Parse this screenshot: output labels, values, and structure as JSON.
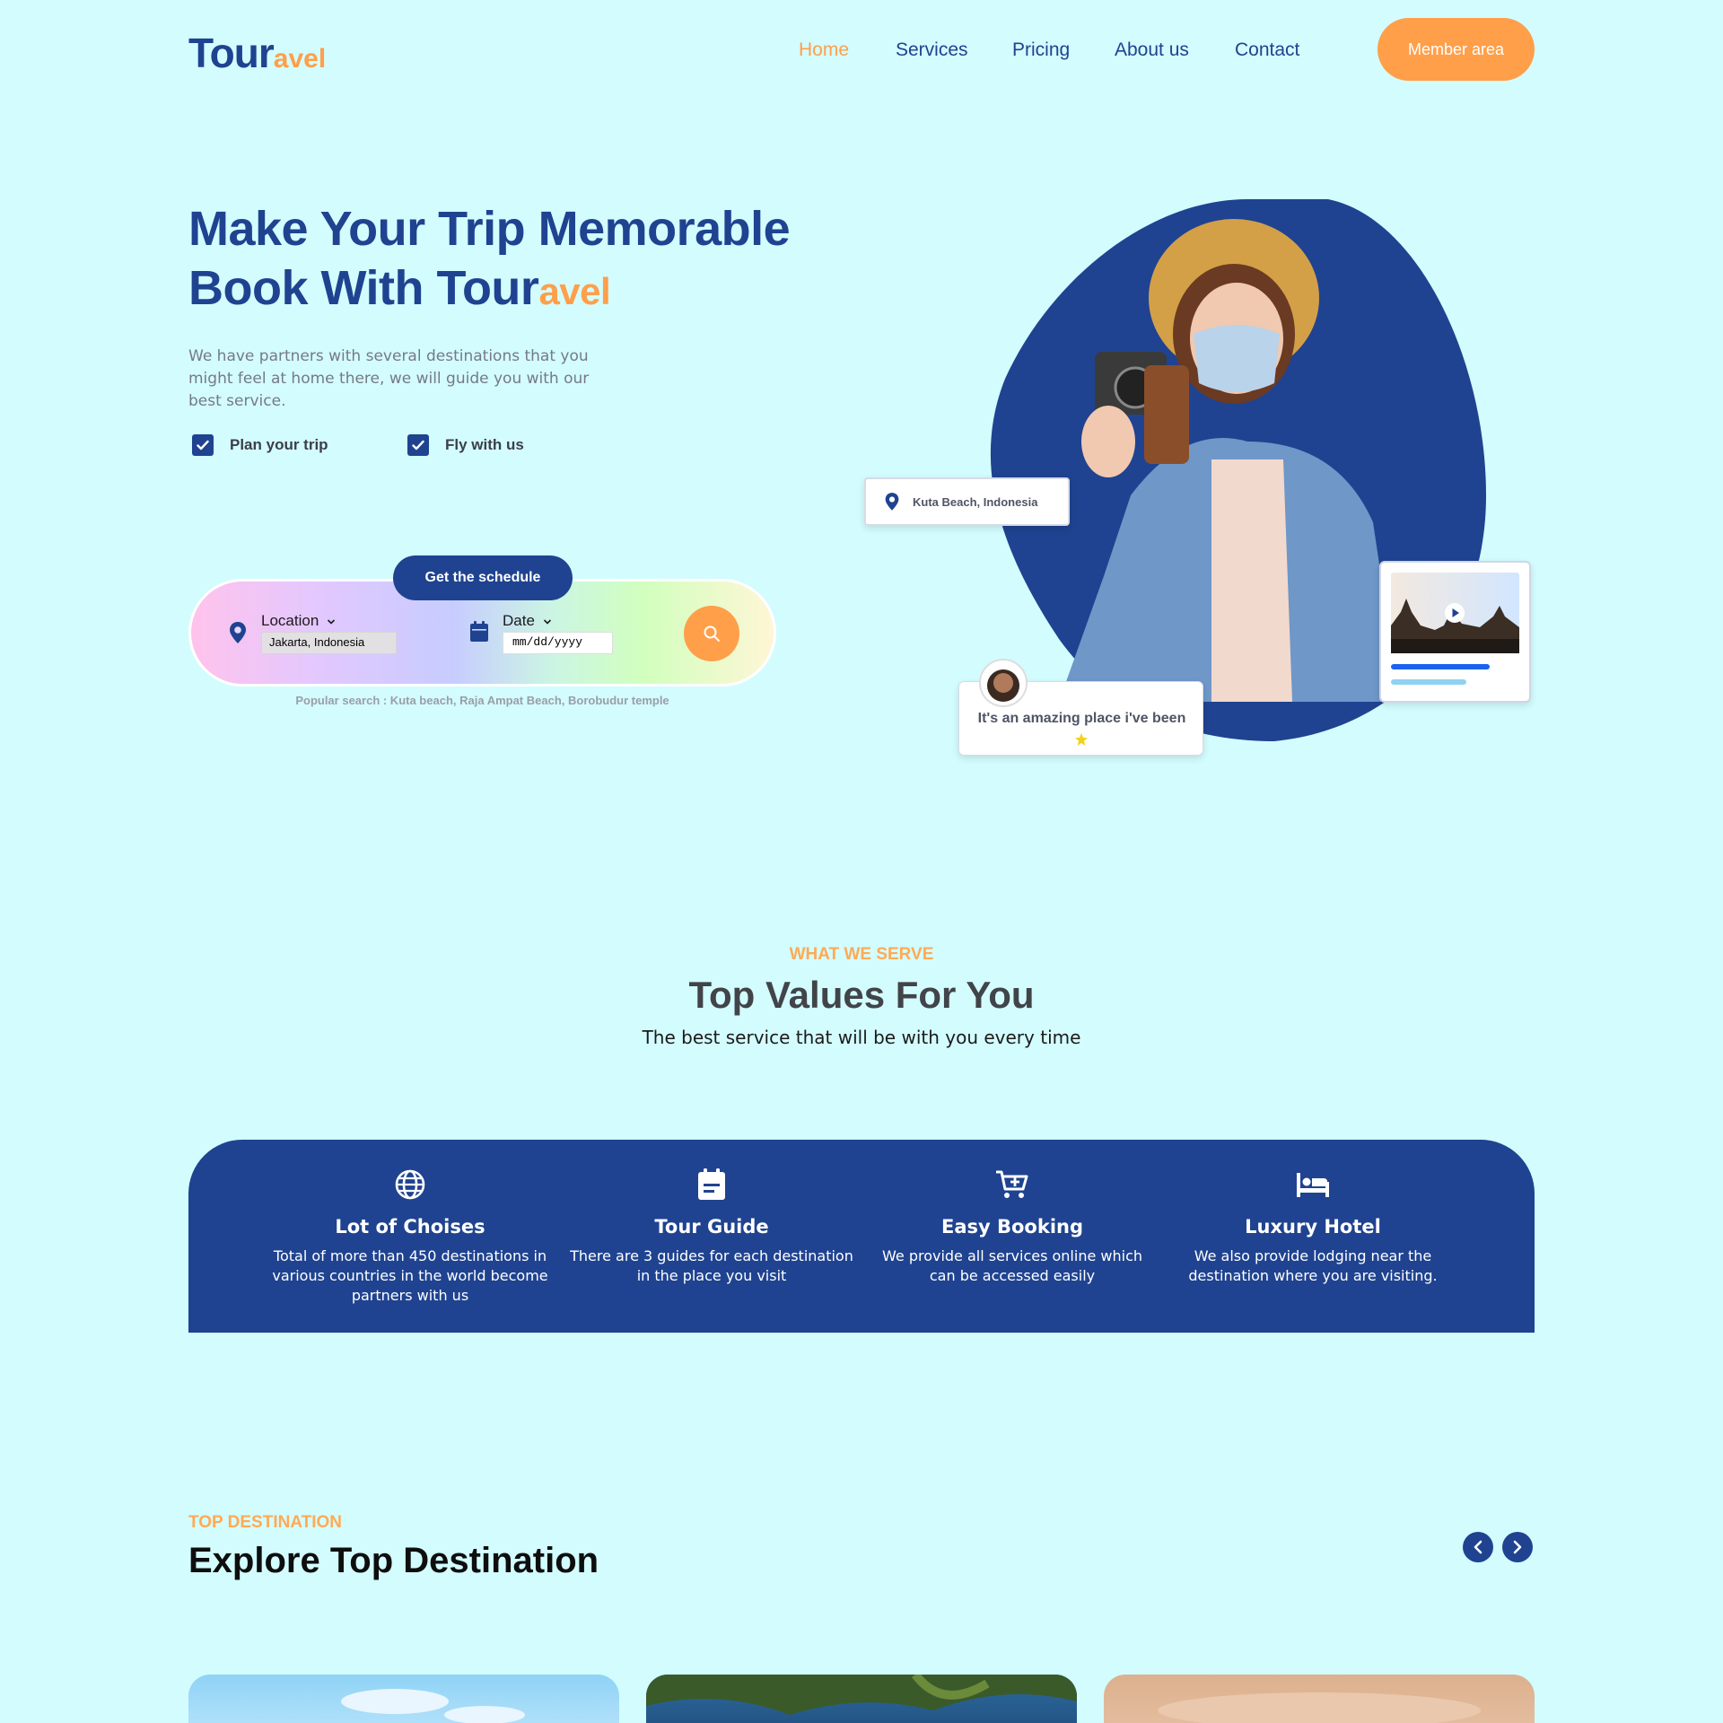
{
  "brand": {
    "name_main": "Tour",
    "name_accent": "avel"
  },
  "nav": {
    "items": [
      "Home",
      "Services",
      "Pricing",
      "About us",
      "Contact"
    ],
    "active": "Home",
    "member_button": "Member area"
  },
  "hero": {
    "title_line1": "Make Your Trip Memorable",
    "title_line2_prefix": "Book With Tour",
    "title_line2_accent": "avel",
    "description": "We have partners with several destinations that you might feel at home there, we will guide you with our best service.",
    "checks": [
      "Plan your trip",
      "Fly with us"
    ]
  },
  "search": {
    "schedule_button": "Get the schedule",
    "location_label": "Location",
    "location_value": "Jakarta, Indonesia",
    "date_label": "Date",
    "date_placeholder": "mm/dd/yyyy",
    "popular": "Popular search : Kuta beach, Raja Ampat Beach, Borobudur temple"
  },
  "hero_cards": {
    "location": "Kuta Beach, Indonesia",
    "review": "It's an amazing place i've been",
    "rating_stars": 1
  },
  "values": {
    "eyebrow": "WHAT WE SERVE",
    "title": "Top Values For You",
    "subtitle": "The best service that will be with you every time",
    "items": [
      {
        "icon": "globe-icon",
        "title": "Lot of Choises",
        "desc": "Total of more than 450 destinations in various countries in the world become partners with us"
      },
      {
        "icon": "calendar-note-icon",
        "title": "Tour Guide",
        "desc": "There are 3 guides for each destination in the place you visit"
      },
      {
        "icon": "cart-icon",
        "title": "Easy Booking",
        "desc": "We provide all services online which can be accessed easily"
      },
      {
        "icon": "bed-icon",
        "title": "Luxury Hotel",
        "desc": "We also provide lodging near the destination where you are visiting."
      }
    ]
  },
  "destinations": {
    "eyebrow": "TOP DESTINATION",
    "title": "Explore Top Destination"
  },
  "colors": {
    "primary": "#1f4390",
    "accent": "#ff9f4a",
    "background": "#d3fcfe"
  }
}
